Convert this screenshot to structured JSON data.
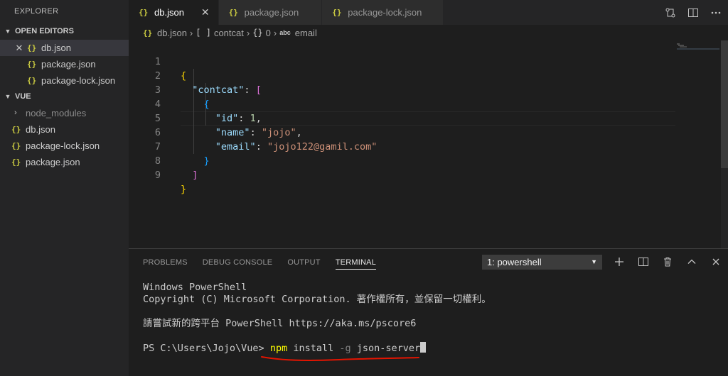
{
  "sidebar": {
    "title": "EXPLORER",
    "open_editors": {
      "label": "OPEN EDITORS",
      "items": [
        {
          "label": "db.json"
        },
        {
          "label": "package.json"
        },
        {
          "label": "package-lock.json"
        }
      ]
    },
    "workspace": {
      "label": "VUE",
      "items": [
        {
          "label": "node_modules"
        },
        {
          "label": "db.json"
        },
        {
          "label": "package-lock.json"
        },
        {
          "label": "package.json"
        }
      ]
    }
  },
  "tabs": [
    {
      "label": "db.json",
      "active": true
    },
    {
      "label": "package.json"
    },
    {
      "label": "package-lock.json"
    }
  ],
  "json_icon_glyph": "{}",
  "breadcrumb": {
    "file": "db.json",
    "array_sym": "[ ]",
    "array_label": "contcat",
    "obj_sym": "{}",
    "obj_label": "0",
    "prop_sym": "abc",
    "prop_label": "email"
  },
  "editor": {
    "line_numbers": [
      "1",
      "2",
      "3",
      "4",
      "5",
      "6",
      "7",
      "8",
      "9"
    ],
    "code": {
      "open_brace": "{",
      "key_contcat": "\"contcat\"",
      "colon": ": ",
      "open_bracket": "[",
      "open_obj": "{",
      "key_id": "\"id\"",
      "val_id": "1",
      "comma": ",",
      "key_name": "\"name\"",
      "val_name": "\"jojo\"",
      "key_email": "\"email\"",
      "val_email": "\"jojo122@gamil.com\"",
      "close_obj": "}",
      "close_bracket": "]",
      "close_brace": "}"
    }
  },
  "panel": {
    "tabs": [
      "PROBLEMS",
      "DEBUG CONSOLE",
      "OUTPUT",
      "TERMINAL"
    ],
    "active_tab": "TERMINAL",
    "terminal_select": "1: powershell",
    "terminal": {
      "line1": "Windows PowerShell",
      "line2": "Copyright (C) Microsoft Corporation. 著作權所有，並保留一切權利。",
      "line3": "請嘗試新的跨平台 PowerShell https://aka.ms/pscore6",
      "prompt": "PS C:\\Users\\Jojo\\Vue> ",
      "cmd_exe": "npm",
      "cmd_arg1": " install ",
      "cmd_flag": "-g",
      "cmd_arg2": " json-server"
    }
  },
  "colors": {
    "annotation_underline": "#e51400",
    "json_icon": "#cbcb41"
  }
}
